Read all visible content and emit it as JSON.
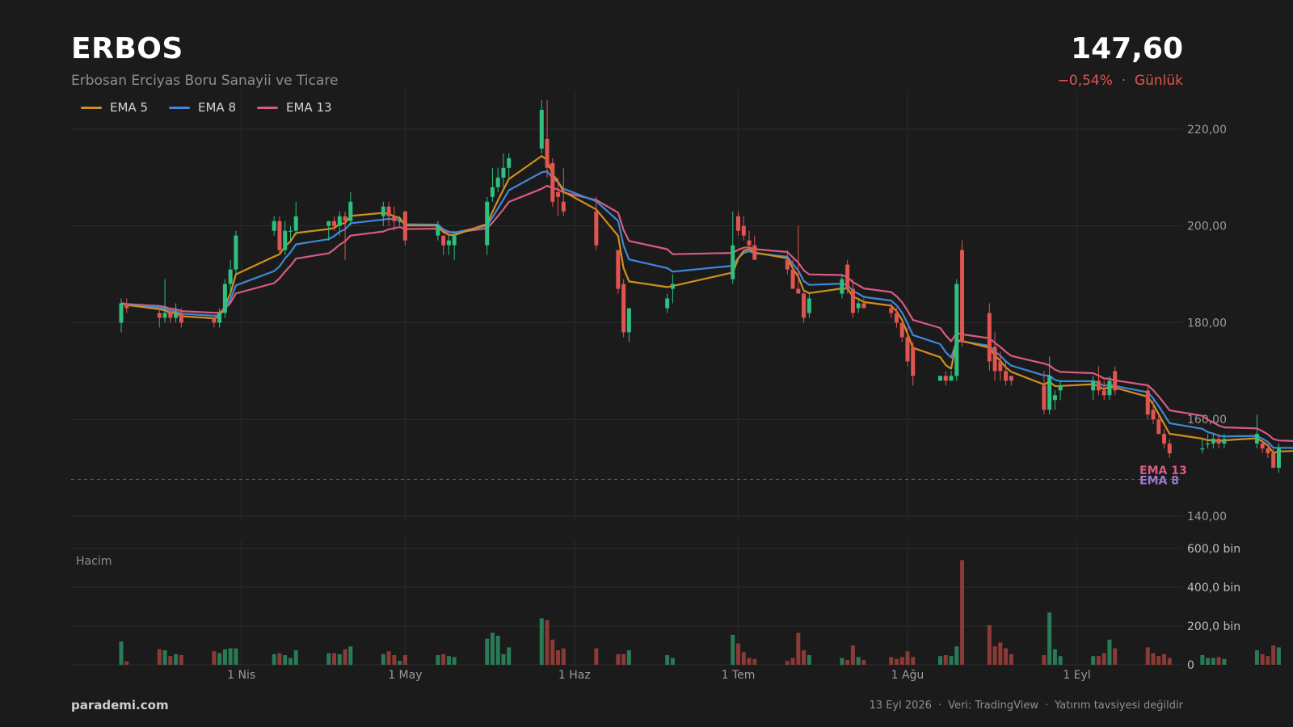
{
  "header": {
    "ticker": "ERBOS",
    "company": "Erbosan Erciyas Boru Sanayii ve Ticare",
    "price": "147,60",
    "change": "−0,54%",
    "period": "Günlük"
  },
  "legend": [
    {
      "name": "EMA 5",
      "color": "#d18f1c"
    },
    {
      "name": "EMA 8",
      "color": "#3f87d9"
    },
    {
      "name": "EMA 13",
      "color": "#d95a85"
    }
  ],
  "colors": {
    "up": "#2fbf7f",
    "down": "#e0554f",
    "up_volume": "#2a7a57",
    "down_volume": "#8c3a36",
    "background": "#1b1b1b"
  },
  "footer": {
    "brand": "parademi.com",
    "date": "13 Eyl 2026",
    "source": "Veri: TradingView",
    "disclaimer": "Yatırım tavsiyesi değildir"
  },
  "chart_data": {
    "type": "candlestick",
    "x_tick_labels": [
      "1 Nis",
      "1 May",
      "1 Haz",
      "1 Tem",
      "1 Ağu",
      "1 Eyl"
    ],
    "x_tick_dates": [
      "2026-04-01",
      "2026-05-01",
      "2026-06-01",
      "2026-07-01",
      "2026-08-01",
      "2026-09-01"
    ],
    "date_range": [
      "2026-03-10",
      "2026-09-11"
    ],
    "price_axis": {
      "ticks": [
        140,
        160,
        180,
        200,
        220
      ],
      "tick_labels": [
        "140,00",
        "160,00",
        "180,00",
        "200,00",
        "220,00"
      ],
      "ylim": [
        139,
        228
      ]
    },
    "volume_axis": {
      "label": "Hacim",
      "ticks": [
        0,
        200000,
        400000,
        600000
      ],
      "tick_labels": [
        "0",
        "200,0 bin",
        "400,0 bin",
        "600,0 bin"
      ],
      "ylim": [
        0,
        650000
      ]
    },
    "last_price": 147.6,
    "end_labels": [
      {
        "name": "EMA 13",
        "value": 148.5,
        "color": "#d95a85"
      },
      {
        "name": "EMA 8",
        "value": 147.9,
        "color": "#9b7ad0"
      }
    ],
    "grid": true,
    "legend_position": "top-left",
    "candles": [
      [
        "2026-03-10",
        180,
        185,
        178,
        184,
        120000
      ],
      [
        "2026-03-11",
        184,
        185,
        182,
        183,
        18000
      ],
      [
        "2026-03-17",
        182,
        183,
        179,
        181,
        80000
      ],
      [
        "2026-03-18",
        181,
        189,
        180,
        182,
        75000
      ],
      [
        "2026-03-19",
        182,
        183,
        180,
        181,
        45000
      ],
      [
        "2026-03-20",
        181,
        184,
        180,
        182,
        55000
      ],
      [
        "2026-03-21",
        182,
        183,
        179,
        180,
        50000
      ],
      [
        "2026-03-27",
        181,
        181,
        179,
        180,
        70000
      ],
      [
        "2026-03-28",
        180,
        183,
        179,
        182,
        60000
      ],
      [
        "2026-03-29",
        182,
        189,
        181,
        188,
        80000
      ],
      [
        "2026-03-30",
        188,
        193,
        186,
        191,
        85000
      ],
      [
        "2026-03-31",
        191,
        199,
        190,
        198,
        85000
      ],
      [
        "2026-04-07",
        199,
        202,
        198,
        201,
        55000
      ],
      [
        "2026-04-08",
        201,
        202,
        194,
        195,
        60000
      ],
      [
        "2026-04-09",
        195,
        201,
        194,
        199,
        50000
      ],
      [
        "2026-04-10",
        199,
        200,
        197,
        199,
        35000
      ],
      [
        "2026-04-11",
        199,
        205,
        198,
        202,
        75000
      ],
      [
        "2026-04-17",
        200,
        201,
        197,
        201,
        60000
      ],
      [
        "2026-04-18",
        201,
        202,
        199,
        200,
        60000
      ],
      [
        "2026-04-19",
        200,
        203,
        198,
        202,
        55000
      ],
      [
        "2026-04-20",
        202,
        203,
        193,
        201,
        80000
      ],
      [
        "2026-04-21",
        201,
        207,
        200,
        205,
        95000
      ],
      [
        "2026-04-27",
        202,
        205,
        200,
        204,
        55000
      ],
      [
        "2026-04-28",
        204,
        205,
        200,
        202,
        70000
      ],
      [
        "2026-04-29",
        202,
        204,
        199,
        201,
        50000
      ],
      [
        "2026-04-30",
        201,
        202,
        200,
        201,
        20000
      ],
      [
        "2026-05-01",
        203,
        203,
        196,
        197,
        50000
      ],
      [
        "2026-05-07",
        198,
        201,
        197,
        200,
        50000
      ],
      [
        "2026-05-08",
        198,
        198,
        194,
        196,
        55000
      ],
      [
        "2026-05-09",
        196,
        198,
        194,
        197,
        45000
      ],
      [
        "2026-05-10",
        196,
        199,
        193,
        198,
        40000
      ],
      [
        "2026-05-16",
        196,
        206,
        194,
        205,
        135000
      ],
      [
        "2026-05-17",
        206,
        212,
        205,
        208,
        165000
      ],
      [
        "2026-05-18",
        208,
        212,
        207,
        210,
        150000
      ],
      [
        "2026-05-19",
        210,
        215,
        208,
        212,
        55000
      ],
      [
        "2026-05-20",
        212,
        215,
        210,
        214,
        90000
      ],
      [
        "2026-05-26",
        216,
        226,
        215,
        224,
        240000
      ],
      [
        "2026-05-27",
        218,
        226,
        210,
        212,
        230000
      ],
      [
        "2026-05-28",
        213,
        214,
        204,
        205,
        130000
      ],
      [
        "2026-05-29",
        207,
        210,
        202,
        206,
        75000
      ],
      [
        "2026-05-30",
        205,
        212,
        202,
        203,
        85000
      ],
      [
        "2026-06-05",
        203,
        206,
        195,
        196,
        85000
      ],
      [
        "2026-06-09",
        195,
        195,
        186,
        187,
        55000
      ],
      [
        "2026-06-10",
        188,
        189,
        177,
        178,
        55000
      ],
      [
        "2026-06-11",
        178,
        183,
        176,
        183,
        75000
      ],
      [
        "2026-06-18",
        183,
        186,
        182,
        185,
        50000
      ],
      [
        "2026-06-19",
        187,
        190,
        184,
        188,
        35000
      ],
      [
        "2026-06-30",
        189,
        203,
        188,
        196,
        155000
      ],
      [
        "2026-07-01",
        202,
        203,
        198,
        199,
        110000
      ],
      [
        "2026-07-02",
        200,
        202,
        197,
        198,
        65000
      ],
      [
        "2026-07-03",
        197,
        199,
        195,
        196,
        35000
      ],
      [
        "2026-07-04",
        196,
        198,
        193,
        193,
        30000
      ],
      [
        "2026-07-10",
        193,
        195,
        190,
        191,
        20000
      ],
      [
        "2026-07-11",
        191,
        193,
        187,
        187,
        35000
      ],
      [
        "2026-07-12",
        187,
        200,
        186,
        186,
        165000
      ],
      [
        "2026-07-13",
        186,
        187,
        180,
        181,
        75000
      ],
      [
        "2026-07-14",
        182,
        186,
        181,
        185,
        50000
      ],
      [
        "2026-07-20",
        186,
        190,
        185,
        189,
        35000
      ],
      [
        "2026-07-21",
        192,
        193,
        186,
        187,
        25000
      ],
      [
        "2026-07-22",
        187,
        189,
        181,
        182,
        100000
      ],
      [
        "2026-07-23",
        183,
        185,
        182,
        184,
        40000
      ],
      [
        "2026-07-24",
        184,
        185,
        183,
        183,
        25000
      ],
      [
        "2026-07-29",
        183,
        184,
        181,
        182,
        40000
      ],
      [
        "2026-07-30",
        182,
        183,
        179,
        180,
        30000
      ],
      [
        "2026-07-31",
        180,
        180,
        176,
        177,
        40000
      ],
      [
        "2026-08-01",
        177,
        179,
        171,
        172,
        70000
      ],
      [
        "2026-08-02",
        175,
        176,
        167,
        169,
        40000
      ],
      [
        "2026-08-07",
        168,
        169,
        168,
        169,
        45000
      ],
      [
        "2026-08-08",
        169,
        170,
        167,
        168,
        50000
      ],
      [
        "2026-08-09",
        168,
        170,
        168,
        169,
        45000
      ],
      [
        "2026-08-10",
        169,
        189,
        168,
        188,
        95000
      ],
      [
        "2026-08-11",
        195,
        197,
        175,
        176,
        540000
      ],
      [
        "2026-08-16",
        182,
        184,
        170,
        172,
        205000
      ],
      [
        "2026-08-17",
        175,
        178,
        168,
        170,
        95000
      ],
      [
        "2026-08-18",
        172,
        174,
        168,
        170,
        115000
      ],
      [
        "2026-08-19",
        170,
        172,
        167,
        168,
        85000
      ],
      [
        "2026-08-20",
        169,
        169,
        167,
        168,
        55000
      ],
      [
        "2026-08-26",
        167,
        170,
        161,
        162,
        50000
      ],
      [
        "2026-08-27",
        162,
        173,
        161,
        169,
        270000
      ],
      [
        "2026-08-28",
        164,
        166,
        162,
        165,
        80000
      ],
      [
        "2026-08-29",
        166,
        168,
        164,
        167,
        45000
      ],
      [
        "2026-09-04",
        166,
        169,
        164,
        168,
        45000
      ],
      [
        "2026-09-05",
        168,
        171,
        165,
        166,
        45000
      ],
      [
        "2026-09-06",
        166,
        168,
        164,
        165,
        60000
      ],
      [
        "2026-09-07",
        165,
        169,
        164,
        168,
        130000
      ],
      [
        "2026-09-08",
        170,
        171,
        165,
        166,
        85000
      ],
      [
        "2026-09-14",
        166,
        167,
        160,
        161,
        90000
      ],
      [
        "2026-09-15",
        162,
        164,
        159,
        160,
        60000
      ],
      [
        "2026-09-16",
        160,
        161,
        157,
        157,
        45000
      ],
      [
        "2026-09-17",
        157,
        158,
        154,
        155,
        55000
      ],
      [
        "2026-09-18",
        155,
        156,
        152,
        153,
        35000
      ],
      [
        "2026-09-24",
        154,
        156,
        153,
        154,
        50000
      ],
      [
        "2026-09-25",
        155,
        157,
        154,
        155,
        35000
      ],
      [
        "2026-09-26",
        155,
        157,
        154,
        156,
        35000
      ],
      [
        "2026-09-27",
        156,
        157,
        154,
        155,
        40000
      ],
      [
        "2026-09-28",
        155,
        157,
        154,
        156,
        30000
      ],
      [
        "2026-10-04",
        155,
        161,
        154,
        157,
        75000
      ],
      [
        "2026-10-05",
        155,
        156,
        153,
        154,
        55000
      ],
      [
        "2026-10-06",
        154,
        155,
        152,
        153,
        45000
      ],
      [
        "2026-10-07",
        153,
        154,
        150,
        150,
        100000
      ],
      [
        "2026-10-08",
        150,
        155,
        149,
        154,
        90000
      ],
      [
        "2026-10-14",
        153,
        155,
        152,
        154,
        55000
      ],
      [
        "2026-10-15",
        154,
        155,
        151,
        152,
        45000
      ],
      [
        "2026-10-16",
        152,
        154,
        151,
        153,
        50000
      ],
      [
        "2026-10-17",
        153,
        155,
        152,
        154,
        65000
      ],
      [
        "2026-10-18",
        154,
        155,
        152,
        153,
        40000
      ],
      [
        "2026-10-24",
        155,
        159,
        153,
        154,
        65000
      ],
      [
        "2026-10-25",
        154,
        157,
        153,
        154,
        60000
      ],
      [
        "2026-10-26",
        154,
        155,
        152,
        153,
        50000
      ],
      [
        "2026-10-27",
        153,
        155,
        152,
        152,
        45000
      ],
      [
        "2026-10-28",
        152,
        154,
        151,
        153,
        45000
      ],
      [
        "2026-11-03",
        151,
        152,
        147,
        148,
        60000
      ],
      [
        "2026-11-04",
        148,
        149,
        145,
        146,
        50000
      ],
      [
        "2026-11-05",
        146,
        147,
        143,
        144,
        60000
      ],
      [
        "2026-11-06",
        144,
        145,
        143,
        144,
        45000
      ],
      [
        "2026-11-07",
        144,
        146,
        143,
        146,
        50000
      ],
      [
        "2026-11-13",
        146,
        148,
        145,
        148,
        25000
      ],
      [
        "2026-11-14",
        148,
        150,
        147,
        149,
        50000
      ],
      [
        "2026-11-15",
        149,
        152,
        144,
        149,
        90000
      ],
      [
        "2026-11-16",
        149,
        150,
        147,
        148,
        25000
      ],
      [
        "2026-11-17",
        148,
        149,
        147,
        147.6,
        25000
      ]
    ]
  }
}
